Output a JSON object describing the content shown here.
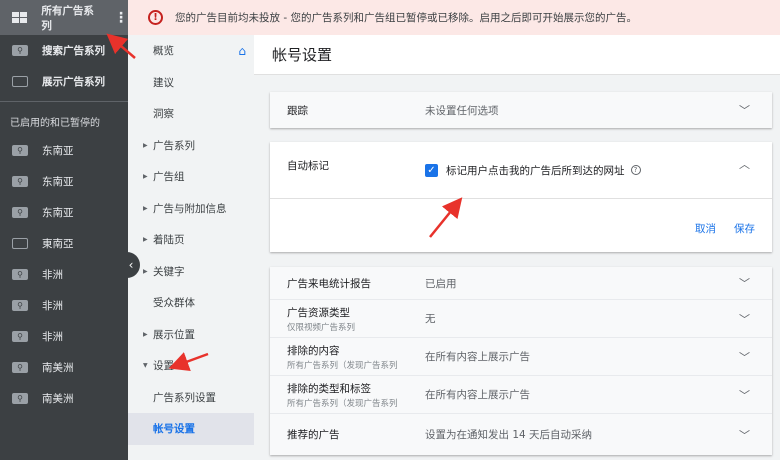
{
  "sidebar": {
    "top_label": "所有广告系列",
    "items": [
      {
        "label": "搜索广告系列",
        "icon": "search-campaign-icon"
      },
      {
        "label": "展示广告系列",
        "icon": "display-campaign-icon"
      }
    ],
    "section_header": "已启用的和已暂停的",
    "campaigns": [
      {
        "label": "东南亚",
        "icon": "search"
      },
      {
        "label": "东南亚",
        "icon": "search"
      },
      {
        "label": "东南亚",
        "icon": "search"
      },
      {
        "label": "東南亞",
        "icon": "display"
      },
      {
        "label": "非洲",
        "icon": "search"
      },
      {
        "label": "非洲",
        "icon": "search"
      },
      {
        "label": "非洲",
        "icon": "search"
      },
      {
        "label": "南美洲",
        "icon": "search"
      },
      {
        "label": "南美洲",
        "icon": "search"
      }
    ]
  },
  "nav": {
    "items": [
      "概览",
      "建议",
      "洞察",
      "广告系列",
      "广告组",
      "广告与附加信息",
      "着陆页",
      "关键字",
      "受众群体",
      "展示位置",
      "设置"
    ],
    "sub": [
      "广告系列设置",
      "帐号设置"
    ],
    "selected": "帐号设置"
  },
  "banner": {
    "text": "您的广告目前均未投放 - 您的广告系列和广告组已暂停或已移除。启用之后即可开始展示您的广告。"
  },
  "header": {
    "title": "帐号设置"
  },
  "tracking": {
    "label": "跟踪",
    "value": "未设置任何选项"
  },
  "auto_tag": {
    "label": "自动标记",
    "checkbox_label": "标记用户点击我的广告后所到达的网址",
    "checked": true,
    "cancel": "取消",
    "save": "保存"
  },
  "settings": [
    {
      "label": "广告来电统计报告",
      "sub": "",
      "value": "已启用"
    },
    {
      "label": "广告资源类型",
      "sub": "仅限视频广告系列",
      "value": "无"
    },
    {
      "label": "排除的内容",
      "sub": "所有广告系列（发现广告系列",
      "value": "在所有内容上展示广告"
    },
    {
      "label": "排除的类型和标签",
      "sub": "所有广告系列（发现广告系列",
      "value": "在所有内容上展示广告"
    },
    {
      "label": "推荐的广告",
      "sub": "",
      "value": "设置为在通知发出 14 天后自动采纳"
    }
  ],
  "colors": {
    "accent": "#1a73e8",
    "sidebar": "#3c4043",
    "banner": "#fce8e6",
    "annotation_arrow": "#e8322b"
  }
}
